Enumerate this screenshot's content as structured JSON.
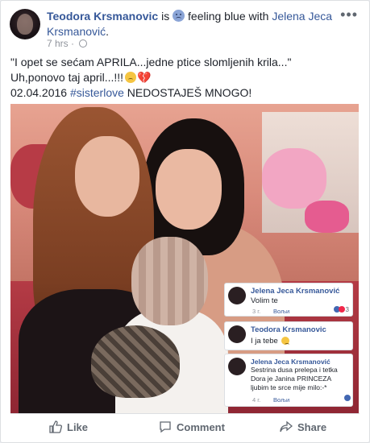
{
  "post": {
    "author": "Teodora Krsmanovic",
    "feeling_prefix": " is ",
    "feeling": "feeling blue",
    "with_text": " with ",
    "tagged": "Jelena Jeca Krsmanović",
    "tagged_suffix": ".",
    "time": "7 hrs",
    "dot": " · ",
    "line1": "\"I opet se sećam APRILA...jedne ptice slomljenih krila...\"",
    "line2": "Uh,ponovo taj april...!!!",
    "line3_date": "02.04.2016 ",
    "line3_tag": "#sisterlove",
    "line3_rest": " NEDOSTAJEŠ MNOGO!"
  },
  "comments": [
    {
      "name": "Jelena Jeca Krsmanović",
      "text": "Volim te",
      "time": "3 г.",
      "reply": "Вољи",
      "reactions": "3"
    },
    {
      "name": "Teodora Krsmanovic",
      "text": "I ja tebe",
      "time": "",
      "reply": "",
      "reactions": ""
    },
    {
      "name": "Jelena Jeca Krsmanović",
      "text1": "Sestrina dusa prelepa i tetka",
      "text2": "Dora je Janina PRINCEZA",
      "text3": "ljubim te srce mije milo:-*",
      "time": "4 г.",
      "reply": "Вољи"
    }
  ],
  "actions": {
    "like": "Like",
    "comment": "Comment",
    "share": "Share"
  },
  "icons": {
    "more": "more-icon",
    "globe": "globe-icon",
    "like": "thumbs-up-icon",
    "comment": "comment-icon",
    "share": "share-icon"
  }
}
